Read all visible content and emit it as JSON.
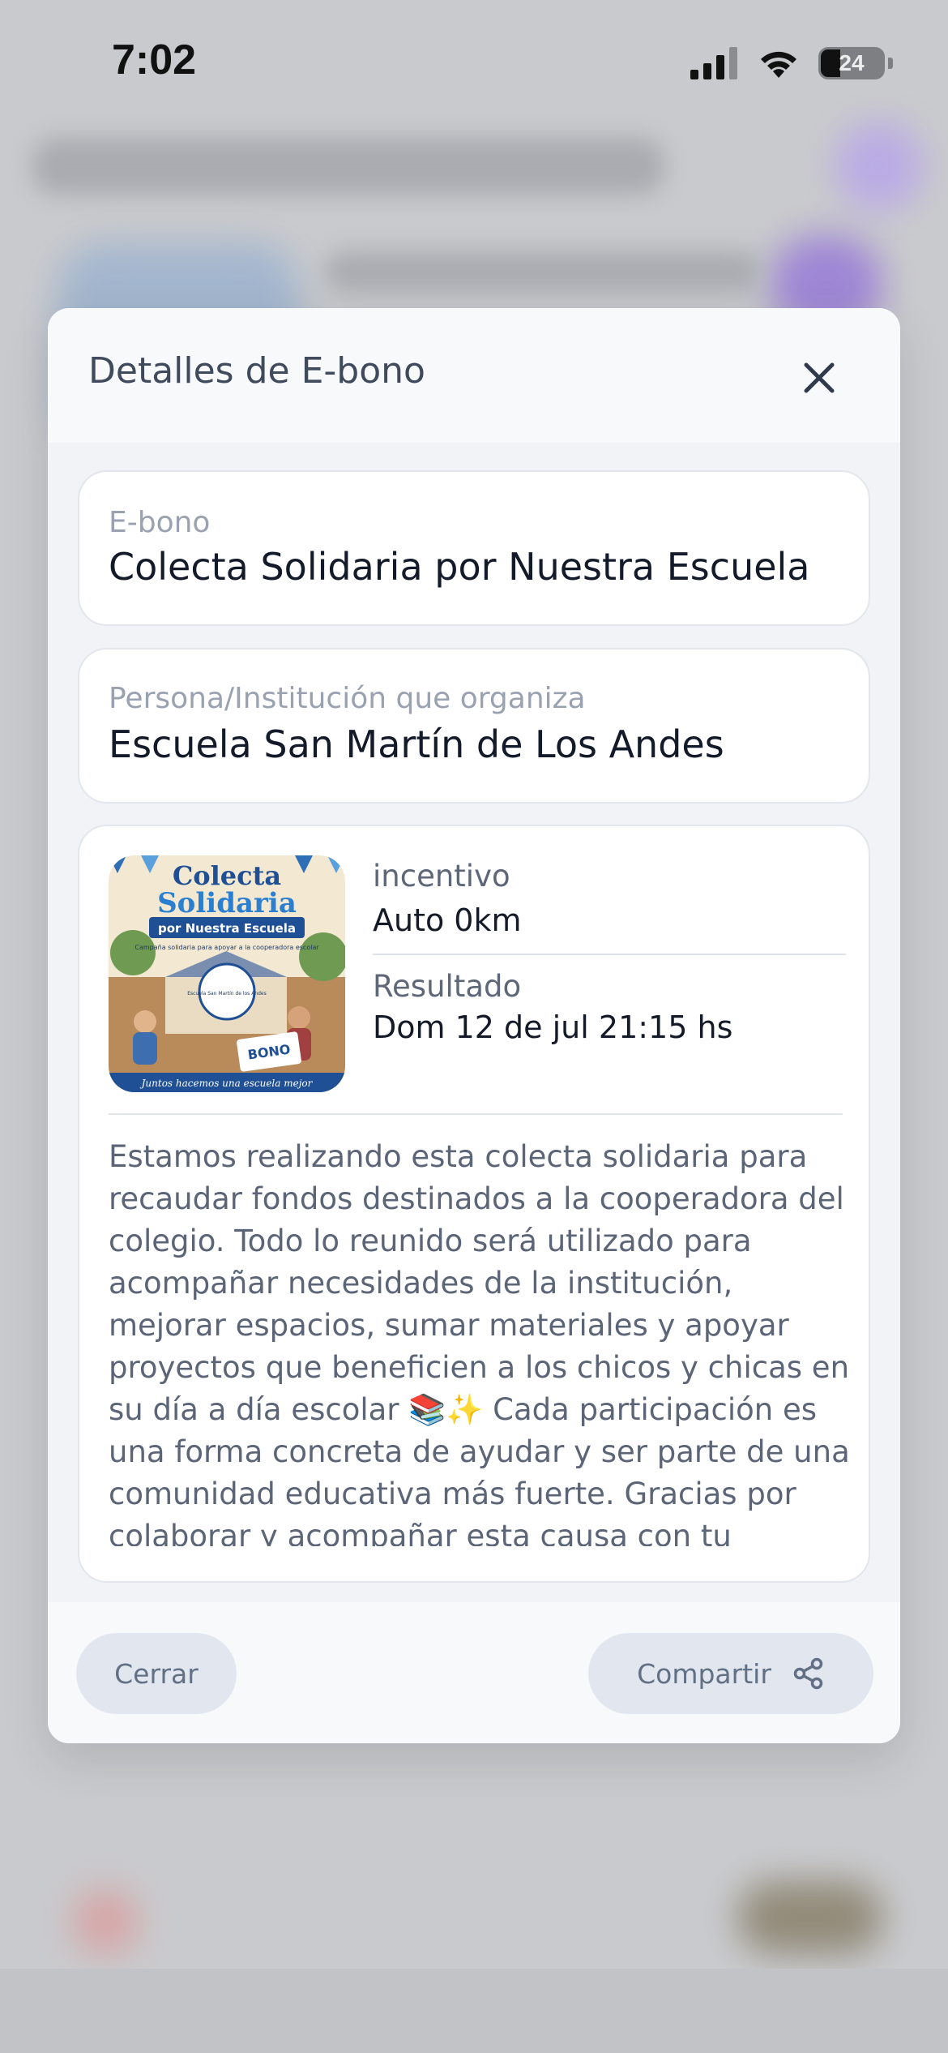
{
  "status_bar": {
    "time": "7:02",
    "battery": "24"
  },
  "modal": {
    "title": "Detalles de E-bono",
    "ebono_card": {
      "label": "E-bono",
      "value": "Colecta Solidaria por Nuestra Escuela"
    },
    "organizer_card": {
      "label": "Persona/Institución que organiza",
      "value": "Escuela San Martín de Los Andes"
    },
    "details_card": {
      "image": {
        "title_line1": "Colecta",
        "title_line2": "Solidaria",
        "banner": "por Nuestra Escuela",
        "tagline": "Campaña solidaria para apoyar a la cooperadora escolar",
        "school_badge": "Escuela San Martín de los Andes",
        "bono": "BONO",
        "footer": "Juntos hacemos una escuela mejor"
      },
      "incentive_label": "incentivo",
      "incentive_value": "Auto 0km",
      "result_label": "Resultado",
      "result_value": "Dom 12 de jul 21:15 hs",
      "description": "Estamos realizando esta colecta solidaria para recaudar fondos destinados a la cooperadora del colegio. Todo lo reunido será utilizado para acompañar necesidades de la institución, mejorar espacios, sumar materiales y apoyar proyectos que beneficien a los chicos y chicas en su día a día escolar 📚✨ Cada participación es una forma concreta de ayudar y ser parte de una comunidad educativa más fuerte. Gracias por colaborar y acompañar esta causa con tu"
    },
    "footer": {
      "close_label": "Cerrar",
      "share_label": "Compartir"
    }
  },
  "icons": {
    "close": "close-icon",
    "share": "share-icon",
    "signal": "signal-icon",
    "wifi": "wifi-icon",
    "battery": "battery-icon"
  },
  "colors": {
    "modal_bg": "#f1f3f7",
    "button_bg": "#e2e7ef",
    "title_text": "#3f4a5c",
    "value_text": "#131a29"
  }
}
